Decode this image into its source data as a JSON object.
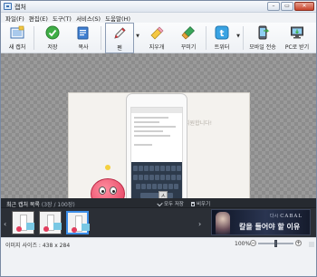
{
  "window": {
    "title": "캡처",
    "controls": [
      "minimize",
      "maximize",
      "close"
    ]
  },
  "menu": [
    "파일(F)",
    "편집(E)",
    "도구(T)",
    "서비스(S)",
    "도움말(H)"
  ],
  "toolbar": {
    "items": [
      {
        "key": "new_capture",
        "label": "새 캡처",
        "icon": "new-capture-icon"
      },
      {
        "key": "save",
        "label": "저장",
        "icon": "save-check-icon"
      },
      {
        "key": "copy",
        "label": "복사",
        "icon": "copy-document-icon"
      },
      {
        "key": "pen",
        "label": "펜",
        "icon": "pen-icon",
        "active": true
      },
      {
        "key": "eraser",
        "label": "지우개",
        "icon": "eraser-icon"
      },
      {
        "key": "decorate",
        "label": "꾸미기",
        "icon": "decorate-brush-icon"
      },
      {
        "key": "twitter",
        "label": "트위터",
        "icon": "twitter-icon"
      },
      {
        "key": "mobile",
        "label": "모바일 전송",
        "icon": "mobile-send-icon"
      },
      {
        "key": "pc",
        "label": "PC로 받기",
        "icon": "pc-receive-icon"
      }
    ]
  },
  "canvas": {
    "promo_text": "안드로이드를 지원합니다!"
  },
  "recent": {
    "title": "최근 캡처 목록",
    "count": "(3장 / 100장)",
    "save_all_label": "모두 저장",
    "clear_label": "비우기",
    "thumbnails": [
      {
        "selected": false
      },
      {
        "selected": false
      },
      {
        "selected": true
      }
    ],
    "ad": {
      "brand_prefix": "다시",
      "brand": "CABAL",
      "copy": "칼을 들어야 할 이유"
    }
  },
  "status": {
    "image_size": "이미지 사이즈 : 438 x 284",
    "zoom": "100%",
    "zoom_level": 0.5
  },
  "colors": {
    "accent_selection": "#3c8ee8",
    "close_button": "#c7442c",
    "panel_dark": "#2b2f36"
  }
}
